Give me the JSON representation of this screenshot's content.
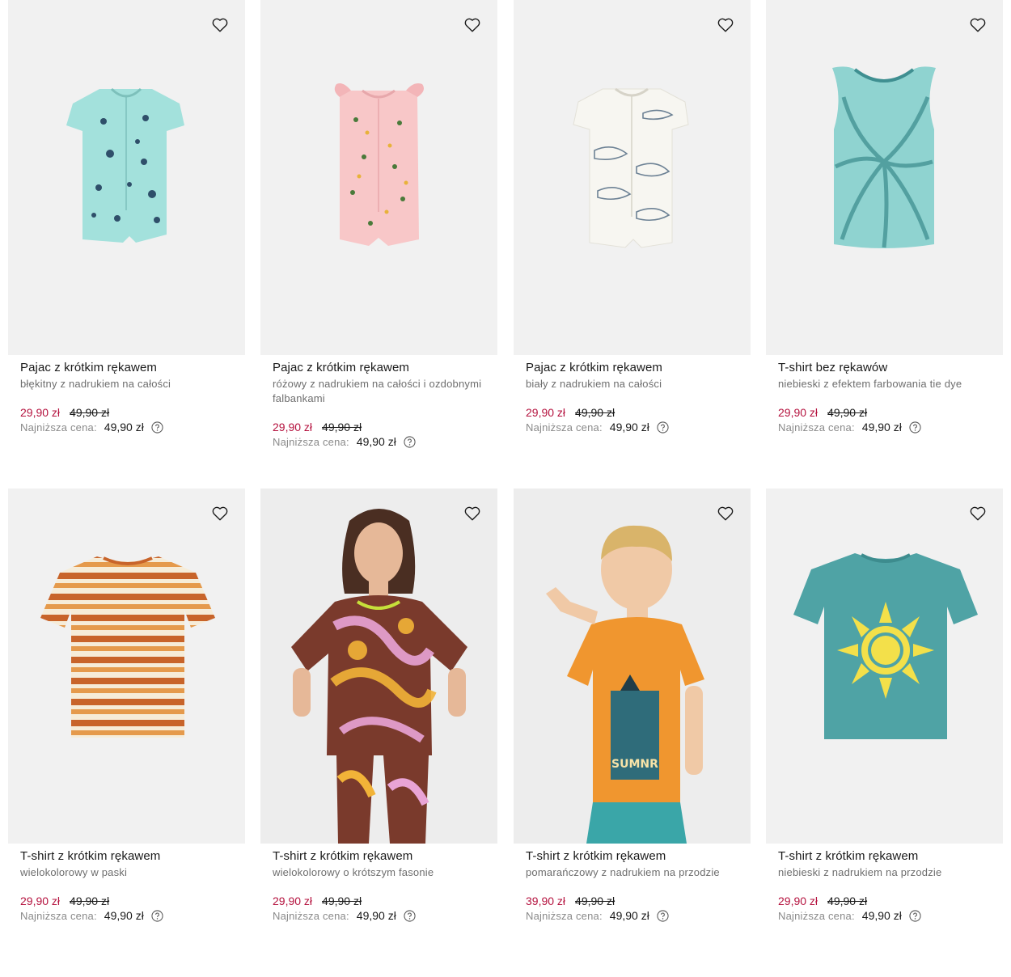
{
  "products": [
    {
      "title": "Pajac z krótkim rękawem",
      "subtitle": "błękitny z nadrukiem na całości",
      "price": "29,90 zł",
      "old_price": "49,90 zł",
      "lowest_label": "Najniższa cena:",
      "lowest_price": "49,90 zł",
      "color": "#9fe0dc"
    },
    {
      "title": "Pajac z krótkim rękawem",
      "subtitle": "różowy z nadrukiem na całości i ozdobnymi falbankami",
      "price": "29,90 zł",
      "old_price": "49,90 zł",
      "lowest_label": "Najniższa cena:",
      "lowest_price": "49,90 zł",
      "color": "#f6c6c8"
    },
    {
      "title": "Pajac z krótkim rękawem",
      "subtitle": "biały z nadrukiem na całości",
      "price": "29,90 zł",
      "old_price": "49,90 zł",
      "lowest_label": "Najniższa cena:",
      "lowest_price": "49,90 zł",
      "color": "#f6f5ef"
    },
    {
      "title": "T-shirt bez rękawów",
      "subtitle": "niebieski z efektem farbowania tie dye",
      "price": "29,90 zł",
      "old_price": "49,90 zł",
      "lowest_label": "Najniższa cena:",
      "lowest_price": "49,90 zł",
      "color": "#8fd3d0"
    },
    {
      "title": "T-shirt z krótkim rękawem",
      "subtitle": "wielokolorowy w paski",
      "price": "29,90 zł",
      "old_price": "49,90 zł",
      "lowest_label": "Najniższa cena:",
      "lowest_price": "49,90 zł",
      "color": "#c7662b"
    },
    {
      "title": "T-shirt z krótkim rękawem",
      "subtitle": "wielokolorowy o krótszym fasonie",
      "price": "29,90 zł",
      "old_price": "49,90 zł",
      "lowest_label": "Najniższa cena:",
      "lowest_price": "49,90 zł",
      "color": "#7a3a2c"
    },
    {
      "title": "T-shirt z krótkim rękawem",
      "subtitle": "pomarańczowy z nadrukiem na przodzie",
      "price": "39,90 zł",
      "old_price": "49,90 zł",
      "lowest_label": "Najniższa cena:",
      "lowest_price": "49,90 zł",
      "color": "#f0962f"
    },
    {
      "title": "T-shirt z krótkim rękawem",
      "subtitle": "niebieski z nadrukiem na przodzie",
      "price": "29,90 zł",
      "old_price": "49,90 zł",
      "lowest_label": "Najniższa cena:",
      "lowest_price": "49,90 zł",
      "color": "#4fa3a5"
    }
  ],
  "icons": {
    "favorite": "heart-outline-icon",
    "help": "question-circle-icon"
  }
}
